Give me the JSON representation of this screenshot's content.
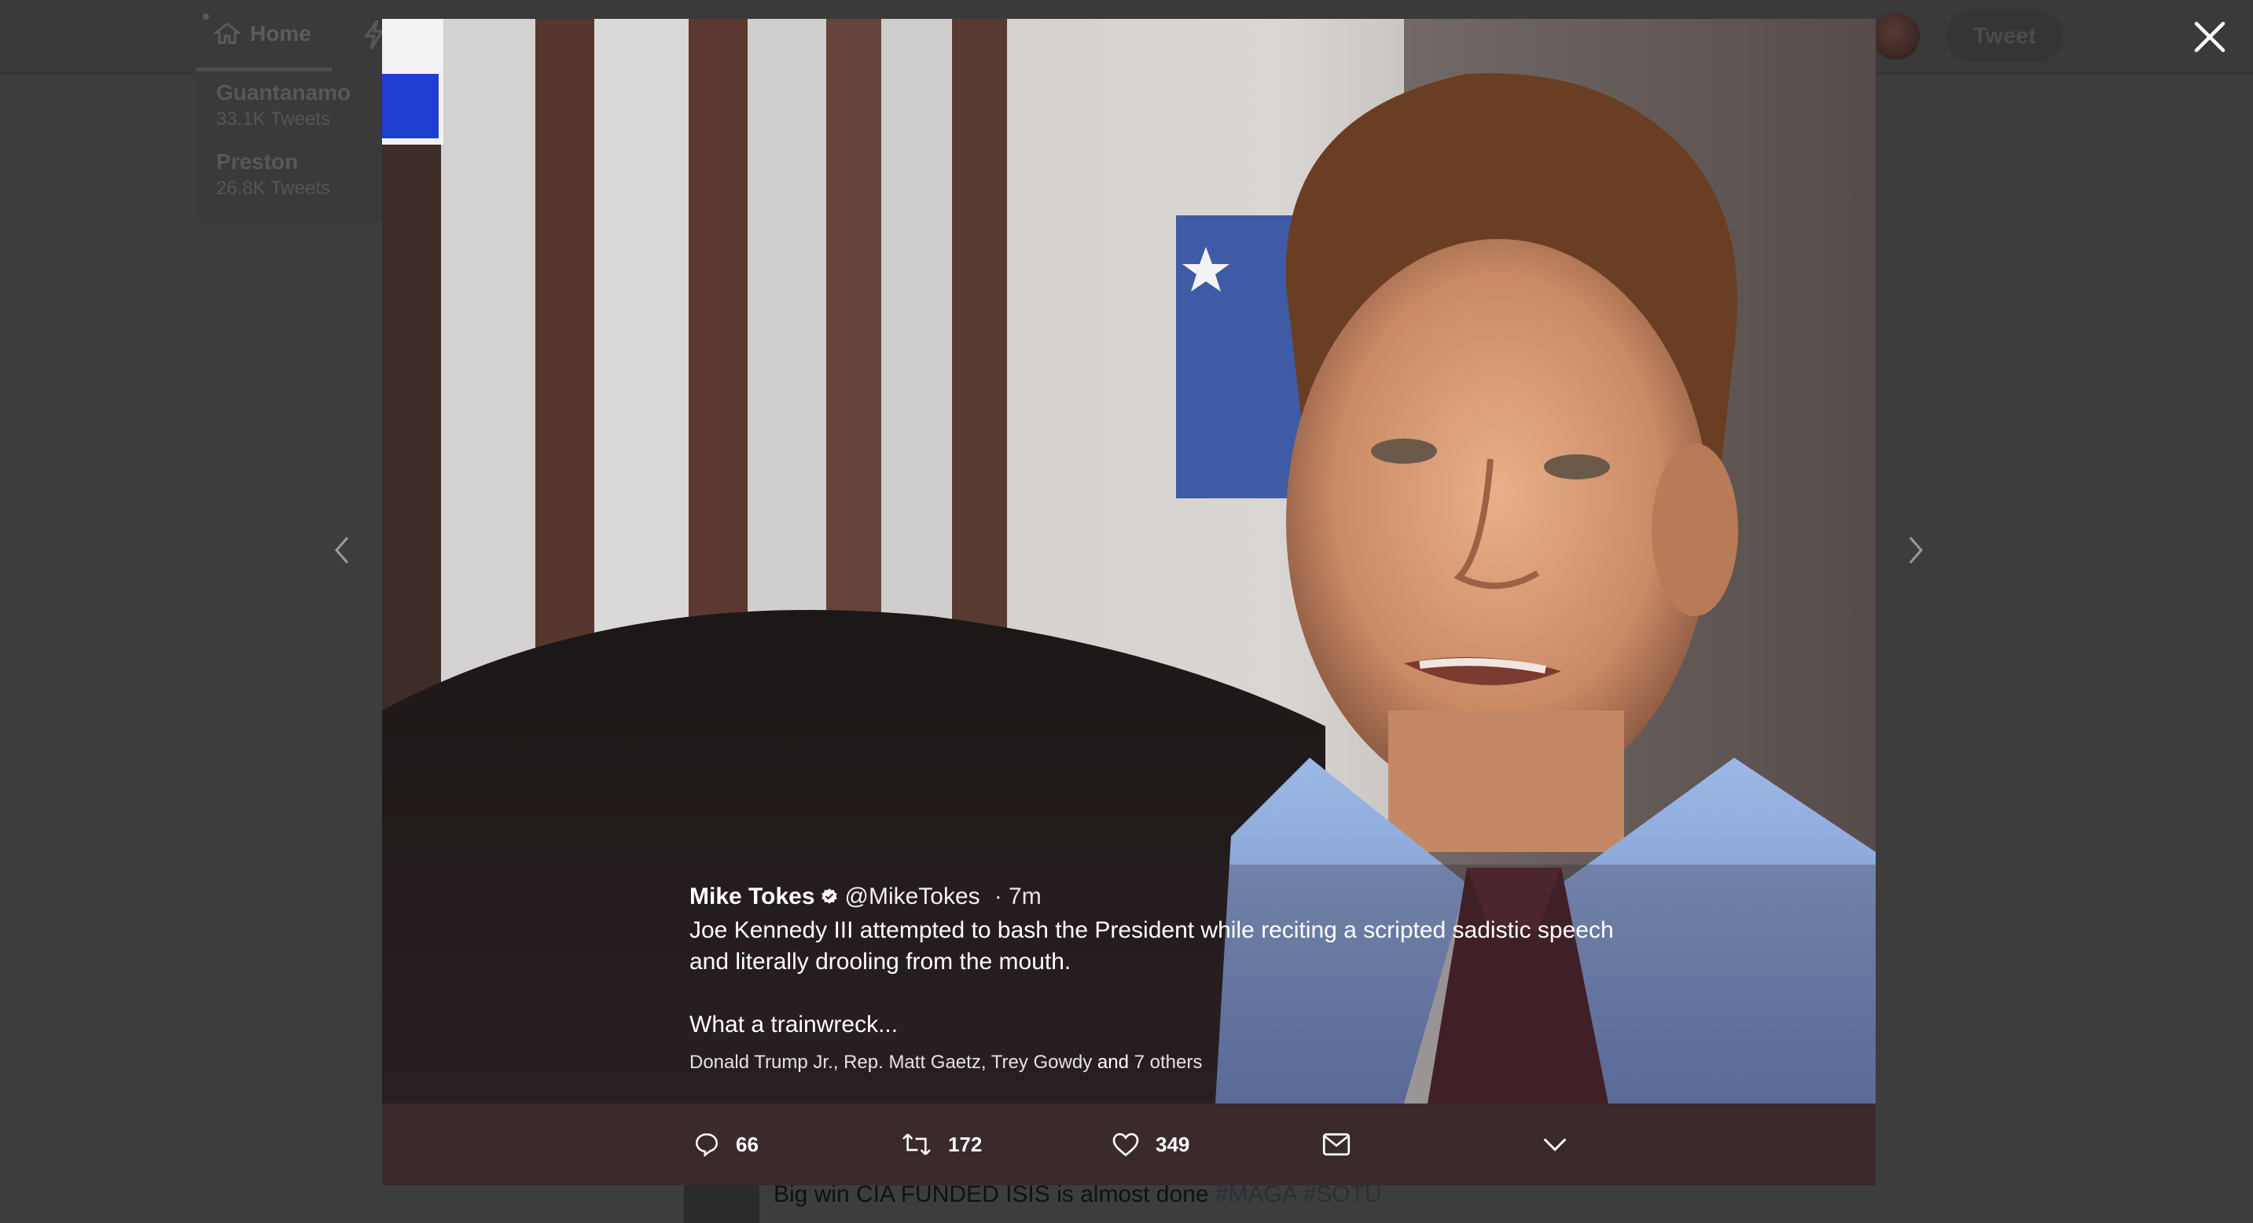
{
  "background": {
    "nav_home_label": "Home",
    "tweet_button_label": "Tweet",
    "trends": [
      {
        "name": "Guantanamo",
        "count": "33.1K Tweets"
      },
      {
        "name": "Preston",
        "count": "26.8K Tweets"
      }
    ],
    "bg_tweet_text": "Big win CIA FUNDED ISIS is almost done ",
    "bg_tweet_tags": "#MAGA #SOTU"
  },
  "tweet": {
    "author_name": "Mike Tokes",
    "handle": "@MikeTokes",
    "time": "· 7m",
    "text_line1": "Joe Kennedy III attempted to bash the President while reciting a scripted sadistic speech",
    "text_line2": "and literally drooling from the mouth.",
    "text_line3": "What a trainwreck...",
    "liked_by": "Donald Trump Jr., Rep. Matt Gaetz, Trey Gowdy",
    "liked_by_and": " and ",
    "liked_by_others": "7 others"
  },
  "actions": {
    "replies": "66",
    "retweets": "172",
    "likes": "349"
  },
  "colors": {
    "overlay_bg": "#3d3d3d",
    "actionbar_bg": "#3a2a2b",
    "text": "#ffffff"
  },
  "icons": [
    "close-icon",
    "chevron-left-icon",
    "chevron-right-icon",
    "reply-icon",
    "retweet-icon",
    "heart-icon",
    "mail-icon",
    "chevron-down-icon",
    "verified-badge-icon",
    "home-icon",
    "moments-icon"
  ]
}
